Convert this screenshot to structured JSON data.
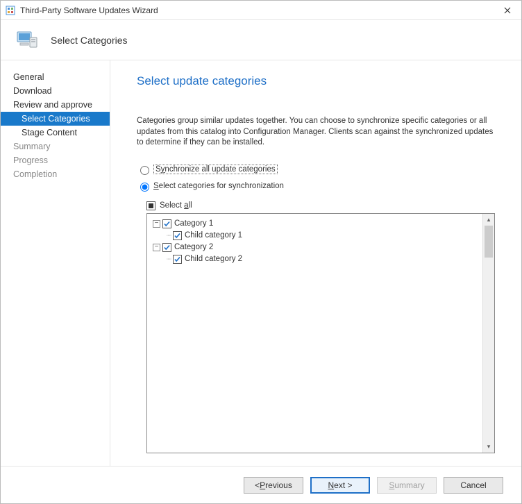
{
  "window": {
    "title": "Third-Party Software Updates Wizard"
  },
  "header": {
    "step_title": "Select Categories"
  },
  "sidebar": {
    "items": [
      {
        "label": "General",
        "type": "normal"
      },
      {
        "label": "Download",
        "type": "normal"
      },
      {
        "label": "Review and approve",
        "type": "normal"
      },
      {
        "label": "Select Categories",
        "type": "selected"
      },
      {
        "label": "Stage Content",
        "type": "sub"
      },
      {
        "label": "Summary",
        "type": "dim"
      },
      {
        "label": "Progress",
        "type": "dim"
      },
      {
        "label": "Completion",
        "type": "dim"
      }
    ]
  },
  "content": {
    "heading": "Select update categories",
    "description": "Categories group similar updates together. You can choose to synchronize specific categories or all updates from this catalog into Configuration Manager. Clients scan against the synchronized updates to determine if they can be installed.",
    "radio_sync_all": "Synchronize all update categories",
    "radio_select": "Select categories for synchronization",
    "select_all_label": "Select all",
    "tree": [
      {
        "label": "Category 1",
        "checked": true,
        "children": [
          {
            "label": "Child category 1",
            "checked": true
          }
        ]
      },
      {
        "label": "Category 2",
        "checked": true,
        "children": [
          {
            "label": "Child category 2",
            "checked": true
          }
        ]
      }
    ]
  },
  "footer": {
    "previous": "Previous",
    "next": "Next",
    "summary": "Summary",
    "cancel": "Cancel"
  }
}
